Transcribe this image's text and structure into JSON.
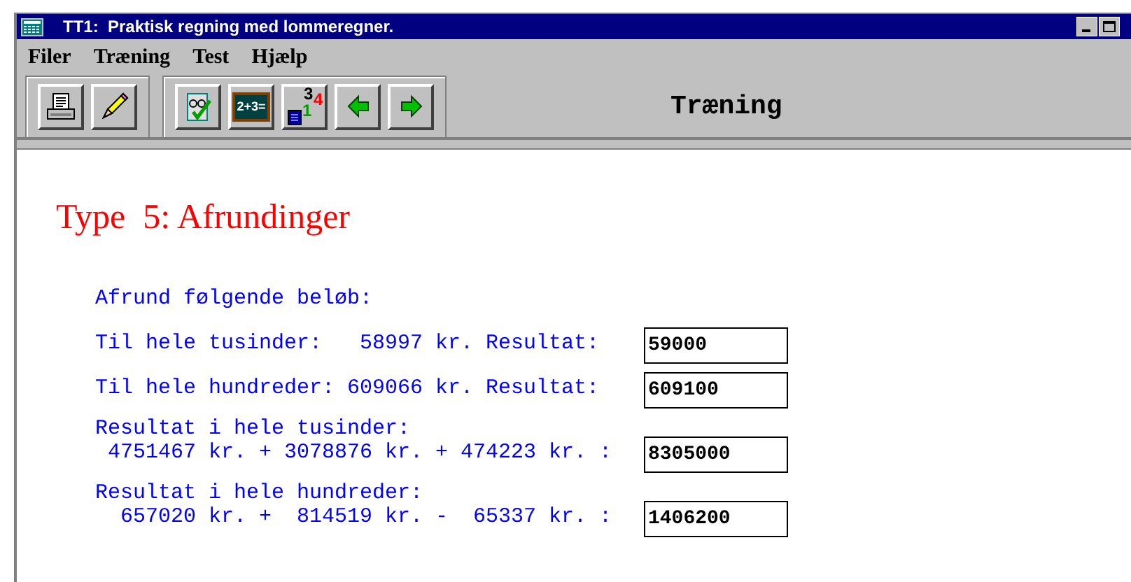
{
  "window": {
    "title": "TT1:  Praktisk regning med lommeregner."
  },
  "menu": [
    "Filer",
    "Træning",
    "Test",
    "Hjælp"
  ],
  "toolbar": {
    "groups": [
      [
        {
          "kind": "printer"
        },
        {
          "kind": "pencil"
        }
      ],
      [
        {
          "kind": "check"
        },
        {
          "kind": "board",
          "label": "2+3="
        },
        {
          "kind": "digits",
          "digits": [
            "3",
            "4",
            "1"
          ]
        },
        {
          "kind": "back"
        },
        {
          "kind": "forward"
        }
      ]
    ],
    "mode": "Træning"
  },
  "heading": "Type  5: Afrundinger",
  "intro": "Afrund følgende beløb:",
  "rows": [
    {
      "lines": [
        "Til hele tusinder:   58997 kr. Resultat:"
      ],
      "answer": "59000"
    },
    {
      "lines": [
        "Til hele hundreder: 609066 kr. Resultat:"
      ],
      "answer": "609100"
    },
    {
      "lines": [
        "Resultat i hele tusinder:",
        " 4751467 kr. + 3078876 kr. + 474223 kr. :"
      ],
      "answer": "8305000"
    },
    {
      "lines": [
        "Resultat i hele hundreder:",
        "  657020 kr. +  814519 kr. -  65337 kr. :"
      ],
      "answer": "1406200"
    }
  ]
}
